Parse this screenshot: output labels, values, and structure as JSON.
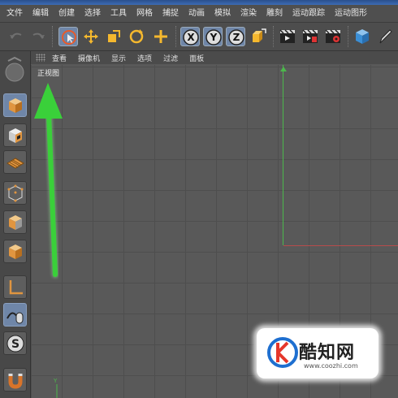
{
  "menubar": {
    "items": [
      "文件",
      "编辑",
      "创建",
      "选择",
      "工具",
      "网格",
      "捕捉",
      "动画",
      "模拟",
      "渲染",
      "雕刻",
      "运动跟踪",
      "运动图形"
    ]
  },
  "toolbar": {
    "buttons": [
      {
        "name": "undo",
        "icon": "undo-icon"
      },
      {
        "name": "redo",
        "icon": "redo-icon"
      },
      {
        "name": "live-select",
        "icon": "live-select-icon"
      },
      {
        "name": "move",
        "icon": "move-icon"
      },
      {
        "name": "scale",
        "icon": "scale-icon"
      },
      {
        "name": "rotate",
        "icon": "rotate-icon"
      },
      {
        "name": "recent-tools",
        "icon": "plus-move-icon"
      },
      {
        "name": "x-axis",
        "label": "X"
      },
      {
        "name": "y-axis",
        "label": "Y"
      },
      {
        "name": "z-axis",
        "label": "Z"
      },
      {
        "name": "coordinate-system",
        "icon": "world-coord-icon"
      },
      {
        "name": "render-view",
        "icon": "render-view-icon"
      },
      {
        "name": "render-picture-viewer",
        "icon": "render-picture-icon"
      },
      {
        "name": "render-settings",
        "icon": "render-settings-icon"
      },
      {
        "name": "cube",
        "icon": "cube-icon"
      },
      {
        "name": "pen",
        "icon": "pen-icon"
      }
    ]
  },
  "left_palette": [
    "model-mode-icon",
    "object-mode-icon",
    "texture-mode-icon",
    "workplane-icon",
    "points-mode-icon",
    "edges-mode-icon",
    "polygons-mode-icon",
    "axis-icon",
    "tweak-mode-icon",
    "snap-icon",
    "magnet-icon"
  ],
  "viewport": {
    "menu": [
      "查看",
      "摄像机",
      "显示",
      "选项",
      "过滤",
      "面板"
    ],
    "label": "正视图"
  },
  "watermark": {
    "name": "酷知网",
    "url": "www.coozhi.com"
  },
  "colors": {
    "y_axis": "#4cb84c",
    "x_axis": "#b84c4c",
    "annotation_arrow": "#3ad03a",
    "active_blue": "#6f86a8"
  }
}
